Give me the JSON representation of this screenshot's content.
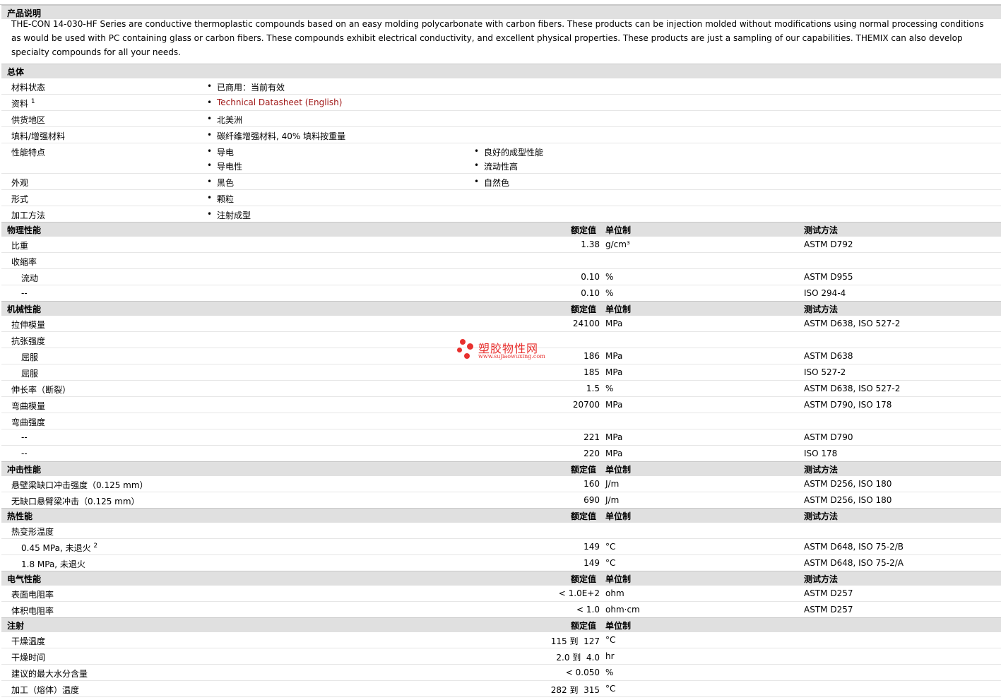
{
  "description": {
    "heading": "产品说明",
    "text": "THE-CON 14-030-HF Series are conductive thermoplastic compounds based on an easy molding polycarbonate with carbon fibers. These products can be injection molded without modifications using normal processing conditions as would be used with PC containing glass or carbon fibers. These compounds exhibit electrical conductivity, and excellent physical properties. These products are just a sampling of our capabilities. THEMIX can also develop specialty compounds for all your needs."
  },
  "general": {
    "heading": "总体",
    "material_status": {
      "label": "材料状态",
      "value": "已商用：当前有效"
    },
    "documents": {
      "label": "资料",
      "sup": "1",
      "link": "Technical Datasheet (English)"
    },
    "availability": {
      "label": "供货地区",
      "value": "北美洲"
    },
    "filler": {
      "label": "填料/增强材料",
      "value": "碳纤维增强材料, 40% 填料按重量"
    },
    "features": {
      "label": "性能特点",
      "items": [
        "导电",
        "导电性",
        "良好的成型性能",
        "流动性高"
      ]
    },
    "appearance": {
      "label": "外观",
      "items": [
        "黑色",
        "自然色"
      ]
    },
    "forms": {
      "label": "形式",
      "value": "颗粒"
    },
    "processing": {
      "label": "加工方法",
      "value": "注射成型"
    }
  },
  "columns": {
    "nominal": "额定值",
    "unit": "单位制",
    "test": "测试方法"
  },
  "physical": {
    "heading": "物理性能",
    "specific_gravity": {
      "label": "比重",
      "value": "1.38",
      "unit": "g/cm³",
      "test": "ASTM D792"
    },
    "shrinkage": {
      "label": "收缩率"
    },
    "shrink_flow": {
      "label": "流动",
      "value": "0.10",
      "unit": "%",
      "test": "ASTM D955"
    },
    "shrink_dash": {
      "label": "--",
      "value": "0.10",
      "unit": "%",
      "test": "ISO 294-4"
    }
  },
  "mechanical": {
    "heading": "机械性能",
    "tensile_modulus": {
      "label": "拉伸模量",
      "value": "24100",
      "unit": "MPa",
      "test": "ASTM D638, ISO 527-2"
    },
    "tensile_strength": {
      "label": "抗张强度"
    },
    "yield_1": {
      "label": "屈服",
      "value": "186",
      "unit": "MPa",
      "test": "ASTM D638"
    },
    "yield_2": {
      "label": "屈服",
      "value": "185",
      "unit": "MPa",
      "test": "ISO 527-2"
    },
    "elongation": {
      "label": "伸长率（断裂）",
      "value": "1.5",
      "unit": "%",
      "test": "ASTM D638, ISO 527-2"
    },
    "flex_modulus": {
      "label": "弯曲模量",
      "value": "20700",
      "unit": "MPa",
      "test": "ASTM D790, ISO 178"
    },
    "flex_strength": {
      "label": "弯曲强度"
    },
    "flex_1": {
      "label": "--",
      "value": "221",
      "unit": "MPa",
      "test": "ASTM D790"
    },
    "flex_2": {
      "label": "--",
      "value": "220",
      "unit": "MPa",
      "test": "ISO 178"
    }
  },
  "impact": {
    "heading": "冲击性能",
    "notched": {
      "label": "悬壁梁缺口冲击强度（0.125 mm）",
      "value": "160",
      "unit": "J/m",
      "test": "ASTM D256, ISO 180"
    },
    "unnotched": {
      "label": "无缺口悬臂梁冲击（0.125 mm）",
      "value": "690",
      "unit": "J/m",
      "test": "ASTM D256, ISO 180"
    }
  },
  "thermal": {
    "heading": "热性能",
    "dtul": {
      "label": "热变形温度"
    },
    "dtul_045": {
      "label": "0.45 MPa, 未退火",
      "sup": "2",
      "value": "149",
      "unit": "°C",
      "test": "ASTM D648, ISO 75-2/B"
    },
    "dtul_18": {
      "label": "1.8 MPa, 未退火",
      "value": "149",
      "unit": "°C",
      "test": "ASTM D648, ISO 75-2/A"
    }
  },
  "electrical": {
    "heading": "电气性能",
    "surface": {
      "label": "表面电阻率",
      "value": "< 1.0E+2",
      "unit": "ohm",
      "test": "ASTM D257"
    },
    "volume": {
      "label": "体积电阻率",
      "value": "< 1.0",
      "unit": "ohm·cm",
      "test": "ASTM D257"
    }
  },
  "injection": {
    "heading": "注射",
    "drying_temp": {
      "label": "干燥温度",
      "value": "115 到  127",
      "unit": "°C"
    },
    "drying_time": {
      "label": "干燥时间",
      "value": "2.0 到  4.0",
      "unit": "hr"
    },
    "moisture": {
      "label": "建议的最大水分含量",
      "value": "< 0.050",
      "unit": "%"
    },
    "melt_temp": {
      "label": "加工（熔体）温度",
      "value": "282 到  315",
      "unit": "°C"
    }
  },
  "watermark": {
    "name": "塑胶物性网",
    "url": "www.sujiaowuxing.com"
  },
  "colors": {
    "header_bg": "#e0e0e0",
    "link": "#a01818",
    "watermark": "#e8302e"
  }
}
